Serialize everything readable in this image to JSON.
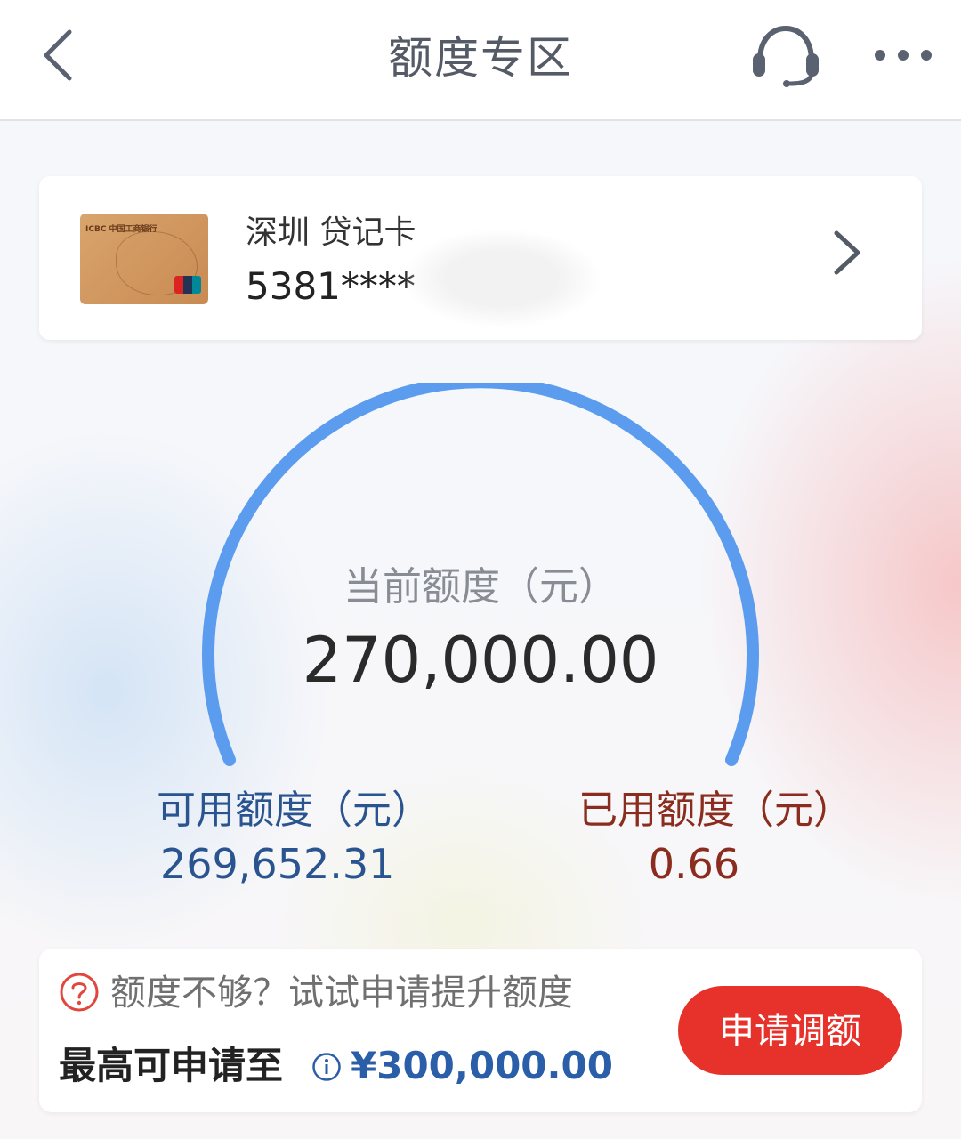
{
  "header": {
    "title": "额度专区",
    "icons": [
      "back-icon",
      "headset-icon",
      "more-icon"
    ]
  },
  "card": {
    "name": "深圳 贷记卡",
    "number": "5381****",
    "image_text": "ICBC 中国工商银行"
  },
  "gauge": {
    "current_label": "当前额度（元）",
    "current_value": "270,000.00",
    "available_label": "可用额度（元）",
    "available_value": "269,652.31",
    "used_label": "已用额度（元）",
    "used_value": "0.66",
    "arc_color": "#5b9cef"
  },
  "promo": {
    "prompt": "额度不够？试试申请提升额度",
    "max_label": "最高可申请至",
    "max_amount": "¥300,000.00",
    "apply_button": "申请调额"
  },
  "colors": {
    "available": "#2a5490",
    "used": "#8a2d1e",
    "apply_button_bg": "#e6322b",
    "max_amount": "#2b5ea8"
  }
}
